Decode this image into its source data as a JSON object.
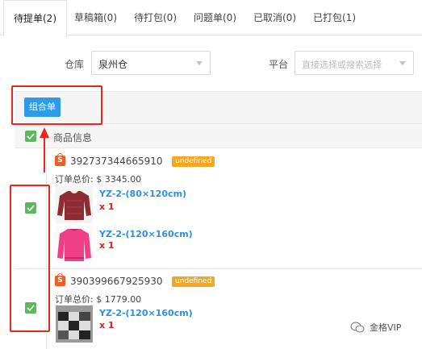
{
  "tabs": [
    {
      "label": "待提单(2)",
      "active": true
    },
    {
      "label": "草稿箱(0)"
    },
    {
      "label": "待打包(0)"
    },
    {
      "label": "问题单(0)"
    },
    {
      "label": "已取消(0)"
    },
    {
      "label": "已打包(1)"
    }
  ],
  "filters": {
    "warehouse_label": "仓库",
    "warehouse_value": "泉州仓",
    "platform_label": "平台",
    "platform_placeholder": "直接选择或搜索选择"
  },
  "toolbar": {
    "combine_label": "组合单"
  },
  "table": {
    "header_label": "商品信息"
  },
  "orders": [
    {
      "id": "392737344665910",
      "badge": "undefined",
      "total": "订单总价: $ 3345.00",
      "items": [
        {
          "sku": "YZ-2-(80×120cm)",
          "qty": "x 1",
          "image": "sweater-red"
        },
        {
          "sku": "YZ-2-(120×160cm)",
          "qty": "x 1",
          "image": "sweater-pink"
        }
      ]
    },
    {
      "id": "390399667925930",
      "badge": "undefined",
      "total": "订单总价: $ 1779.00",
      "items": [
        {
          "sku": "YZ-2-(120×160cm)",
          "qty": "x 1",
          "image": "rug-black-white"
        }
      ]
    }
  ],
  "watermark": "金格VIP",
  "colors": {
    "accent": "#2d9be8",
    "checkbox": "#5cb85c",
    "badge": "#f5a623",
    "highlight": "#e8271f",
    "sku_link": "#2d8fe0",
    "qty": "#e02020",
    "shop": "#f25d22"
  }
}
